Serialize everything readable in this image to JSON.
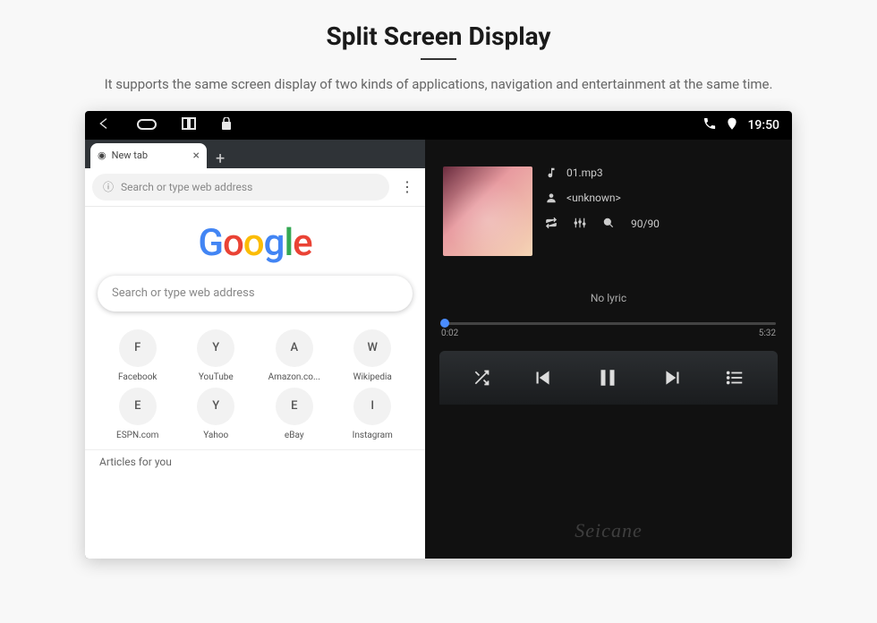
{
  "header": {
    "title": "Split Screen Display",
    "subtitle": "It supports the same screen display of two kinds of applications, navigation and entertainment at the same time."
  },
  "statusbar": {
    "time": "19:50"
  },
  "browser": {
    "tab_label": "New tab",
    "url_placeholder": "Search or type web address",
    "search_placeholder": "Search or type web address",
    "shortcuts": [
      {
        "letter": "F",
        "label": "Facebook"
      },
      {
        "letter": "Y",
        "label": "YouTube"
      },
      {
        "letter": "A",
        "label": "Amazon.co..."
      },
      {
        "letter": "W",
        "label": "Wikipedia"
      },
      {
        "letter": "E",
        "label": "ESPN.com"
      },
      {
        "letter": "Y",
        "label": "Yahoo"
      },
      {
        "letter": "E",
        "label": "eBay"
      },
      {
        "letter": "I",
        "label": "Instagram"
      }
    ],
    "articles_label": "Articles for you"
  },
  "player": {
    "track": "01.mp3",
    "artist": "<unknown>",
    "track_index": "90/90",
    "no_lyric": "No lyric",
    "elapsed": "0:02",
    "total": "5:32"
  },
  "watermark": "Seicane"
}
